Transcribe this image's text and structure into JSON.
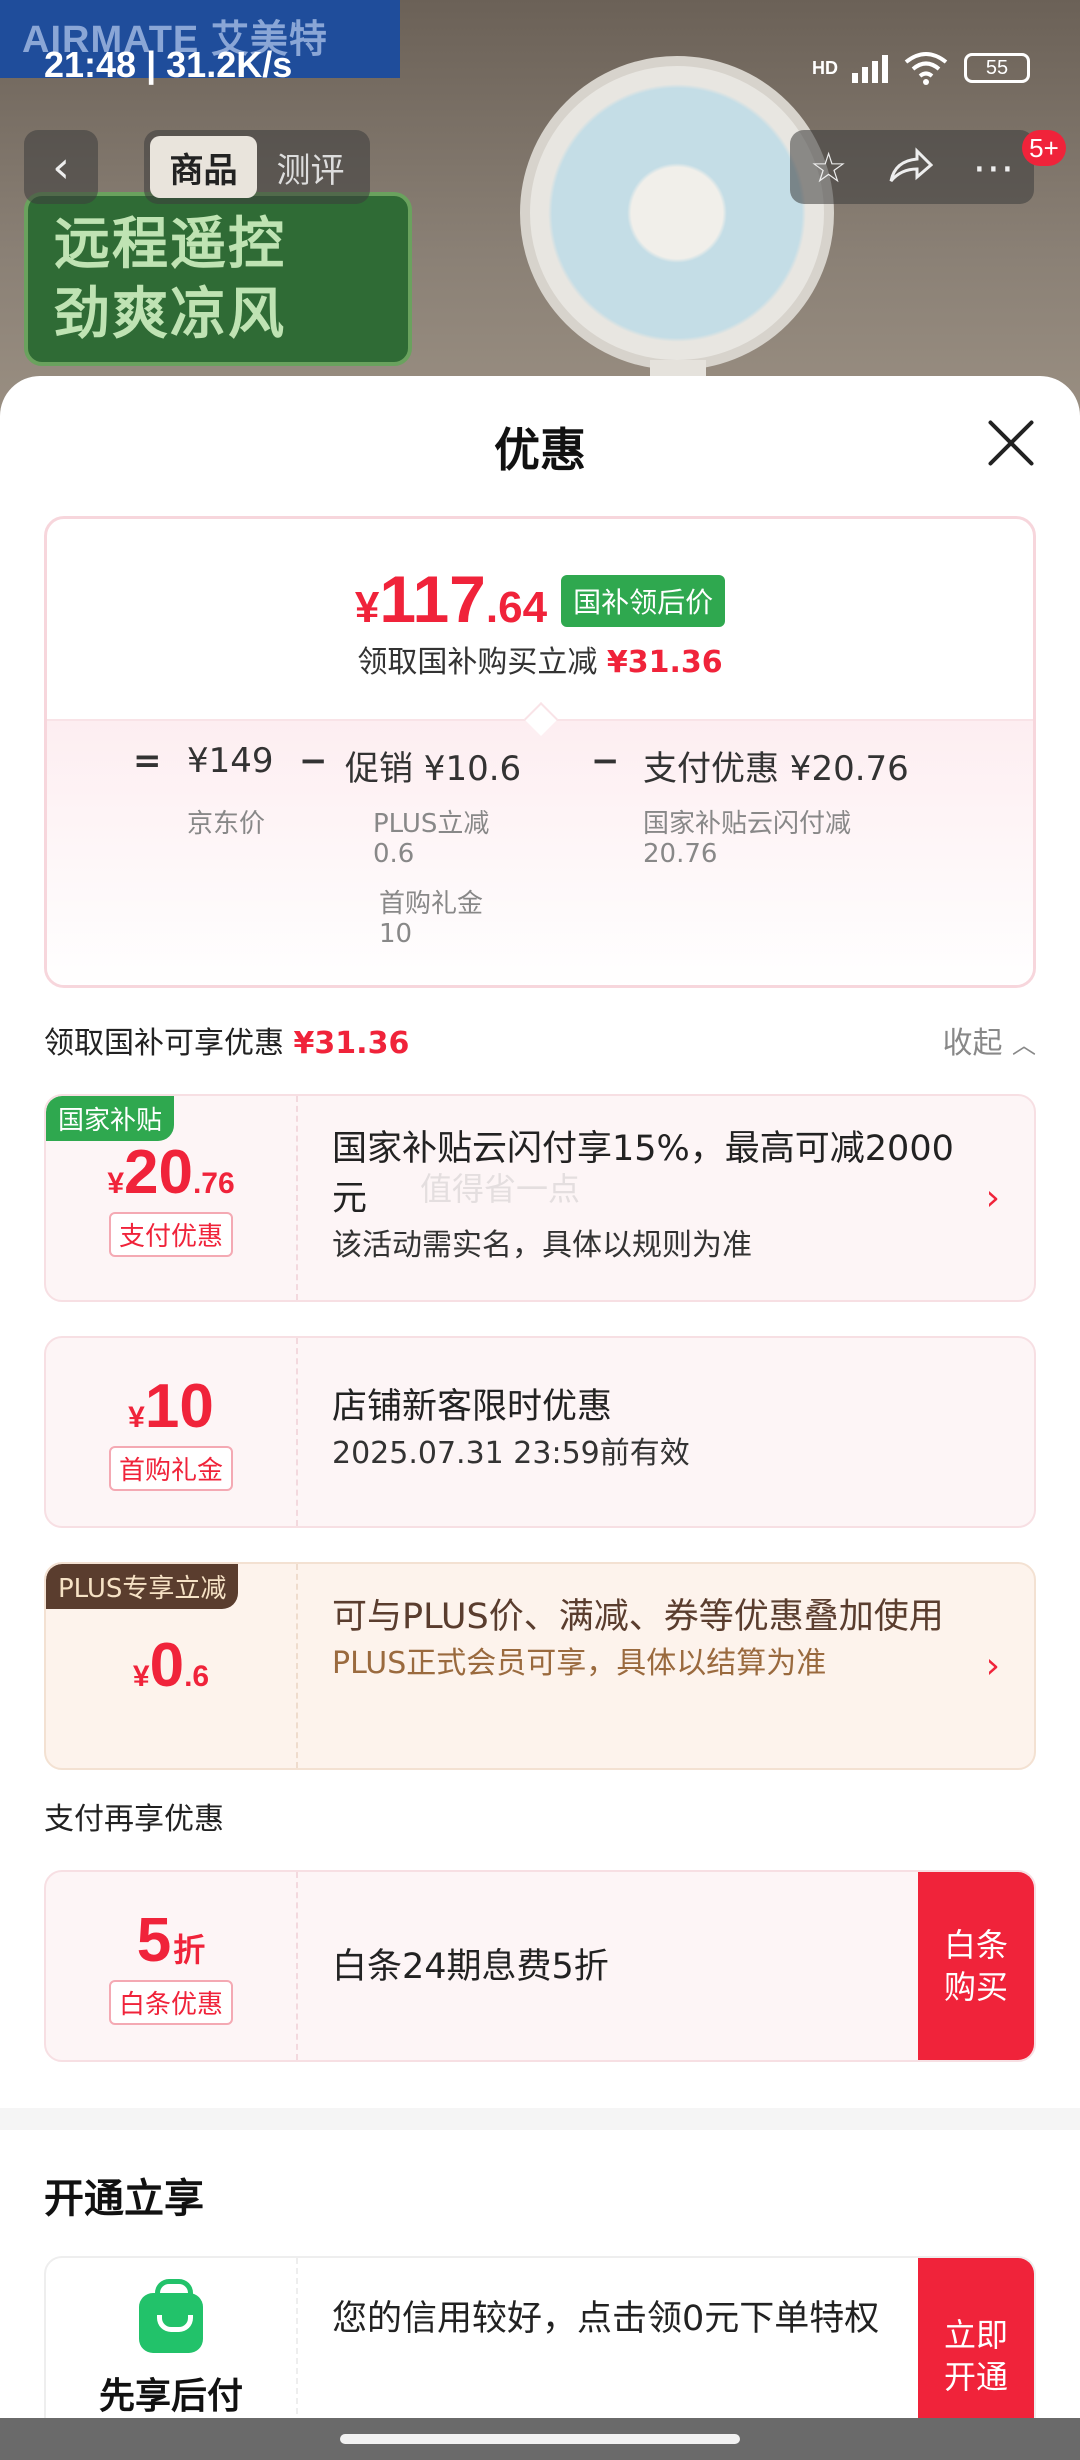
{
  "background": {
    "brand": "AIRMATE 艾美特",
    "promo_lines": [
      "远程遥控",
      "劲爽凉风"
    ],
    "nav": {
      "back_icon": "back-arrow-icon",
      "tabs": [
        "商品",
        "测评"
      ],
      "active_tab": "商品",
      "badge": "5+"
    }
  },
  "status_bar": {
    "time": "21:48 | 31.2K/s",
    "network": "HD",
    "battery": "55"
  },
  "sheet": {
    "title": "优惠"
  },
  "summary": {
    "price_currency": "¥",
    "price_int": "117",
    "price_dec": ".64",
    "price_tag": "国补领后价",
    "sub_label": "领取国补购买立减",
    "sub_amount": "¥31.36",
    "formula": {
      "eq": "=",
      "base": "¥149",
      "base_label": "京东价",
      "minus1": "−",
      "promo": "促销 ¥10.6",
      "promo_items": [
        "PLUS立减",
        "0.6",
        "首购礼金",
        "10"
      ],
      "minus2": "−",
      "pay": "支付优惠 ¥20.76",
      "pay_items": [
        "国家补贴云闪付减",
        "20.76"
      ]
    }
  },
  "section1": {
    "label": "领取国补可享优惠",
    "amount": "¥31.36",
    "collapse": "收起"
  },
  "cards": [
    {
      "corner": "国家补贴",
      "cur": "¥",
      "int": "20",
      "dec": ".76",
      "pill": "支付优惠",
      "title": "国家补贴云闪付享15%，最高可减2000元",
      "desc": "该活动需实名，具体以规则为准"
    },
    {
      "cur": "¥",
      "int": "10",
      "pill": "首购礼金",
      "title": "店铺新客限时优惠",
      "desc": "2025.07.31 23:59前有效"
    },
    {
      "corner": "PLUS专享立减",
      "cur": "¥",
      "int": "0",
      "dec": ".6",
      "title": "可与PLUS价、满减、券等优惠叠加使用",
      "desc": "PLUS正式会员可享，具体以结算为准"
    }
  ],
  "section2": {
    "label": "支付再享优惠"
  },
  "baitiao": {
    "int": "5",
    "unit": "折",
    "pill": "白条优惠",
    "title": "白条24期息费5折",
    "button": "白条购买"
  },
  "section3": {
    "label": "开通立享"
  },
  "service": {
    "name": "先享后付",
    "title": "您的信用较好，点击领0元下单特权",
    "button": "立即开通"
  },
  "watermark": "值得省一点",
  "colors": {
    "accent_red": "#f0233a",
    "green_tag": "#2fa84f",
    "plus_brown": "#5a3d2e"
  }
}
